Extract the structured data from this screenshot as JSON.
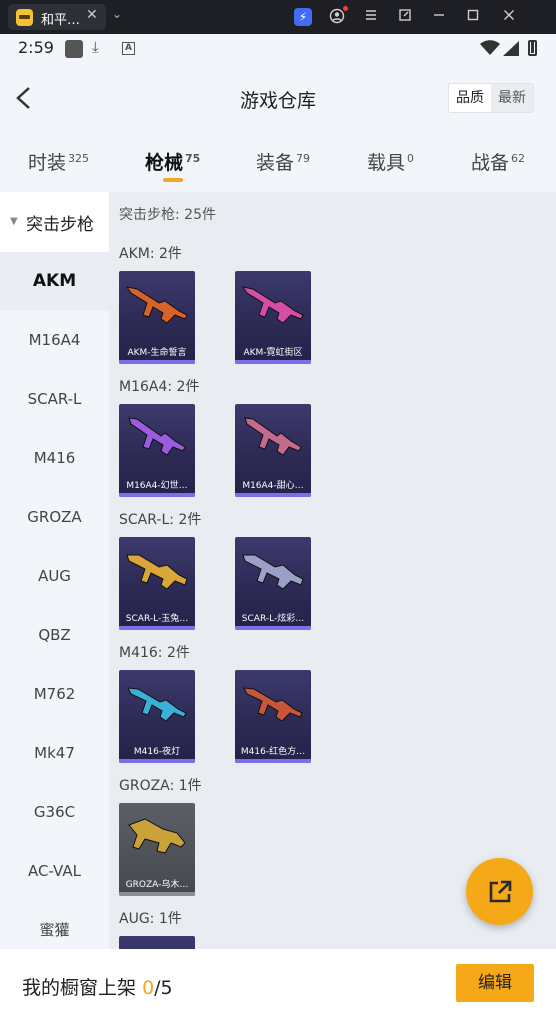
{
  "emulator": {
    "tab_title": "和平…",
    "close_glyph": "✕",
    "chevron_glyph": "⌄",
    "icons": [
      "bolt-icon",
      "account-icon",
      "menu-icon",
      "window-icon",
      "minimize-icon",
      "maximize-icon",
      "close-icon"
    ]
  },
  "status_bar": {
    "time": "2:59",
    "icons": [
      "app-icon",
      "download-icon",
      "a-icon",
      "wifi-icon",
      "signal-icon",
      "battery-icon"
    ]
  },
  "header": {
    "title": "游戏仓库",
    "sort_options": [
      {
        "label": "品质",
        "active": true
      },
      {
        "label": "最新",
        "active": false
      }
    ]
  },
  "tabs": [
    {
      "label": "时装",
      "count": "325",
      "active": false
    },
    {
      "label": "枪械",
      "count": "75",
      "active": true
    },
    {
      "label": "装备",
      "count": "79",
      "active": false
    },
    {
      "label": "载具",
      "count": "0",
      "active": false
    },
    {
      "label": "战备",
      "count": "62",
      "active": false
    }
  ],
  "sidebar": {
    "category": "突击步枪",
    "items": [
      "AKM",
      "M16A4",
      "SCAR-L",
      "M416",
      "GROZA",
      "AUG",
      "QBZ",
      "M762",
      "Mk47",
      "G36C",
      "AC-VAL",
      "蜜獾"
    ],
    "active_item": "AKM"
  },
  "content": {
    "summary": "突击步枪: 25件",
    "groups": [
      {
        "title": "AKM: 2件",
        "items": [
          {
            "label": "AKM-生命誓言",
            "color": "#d9622b"
          },
          {
            "label": "AKM-霓虹街区",
            "color": "#d44ea8"
          }
        ]
      },
      {
        "title": "M16A4: 2件",
        "items": [
          {
            "label": "M16A4-幻世…",
            "color": "#9b5de0"
          },
          {
            "label": "M16A4-甜心…",
            "color": "#c46a8f"
          }
        ]
      },
      {
        "title": "SCAR-L: 2件",
        "items": [
          {
            "label": "SCAR-L-玉兔…",
            "color": "#d9a63a"
          },
          {
            "label": "SCAR-L-炫彩…",
            "color": "#9aa0c8"
          }
        ]
      },
      {
        "title": "M416: 2件",
        "items": [
          {
            "label": "M416-夜灯",
            "color": "#3bb0d6"
          },
          {
            "label": "M416-红色方…",
            "color": "#c9563a"
          }
        ]
      },
      {
        "title": "GROZA: 1件",
        "items": [
          {
            "label": "GROZA-乌木…",
            "color": "#c9a23a",
            "grey": true
          }
        ]
      },
      {
        "title": "AUG: 1件",
        "items": [
          {
            "label": "",
            "color": "#6a6e7a"
          }
        ]
      }
    ]
  },
  "fab": {
    "icon": "share-external-icon"
  },
  "bottom_bar": {
    "label": "我的橱窗上架",
    "count": "0",
    "total": "/5",
    "edit_label": "编辑"
  }
}
